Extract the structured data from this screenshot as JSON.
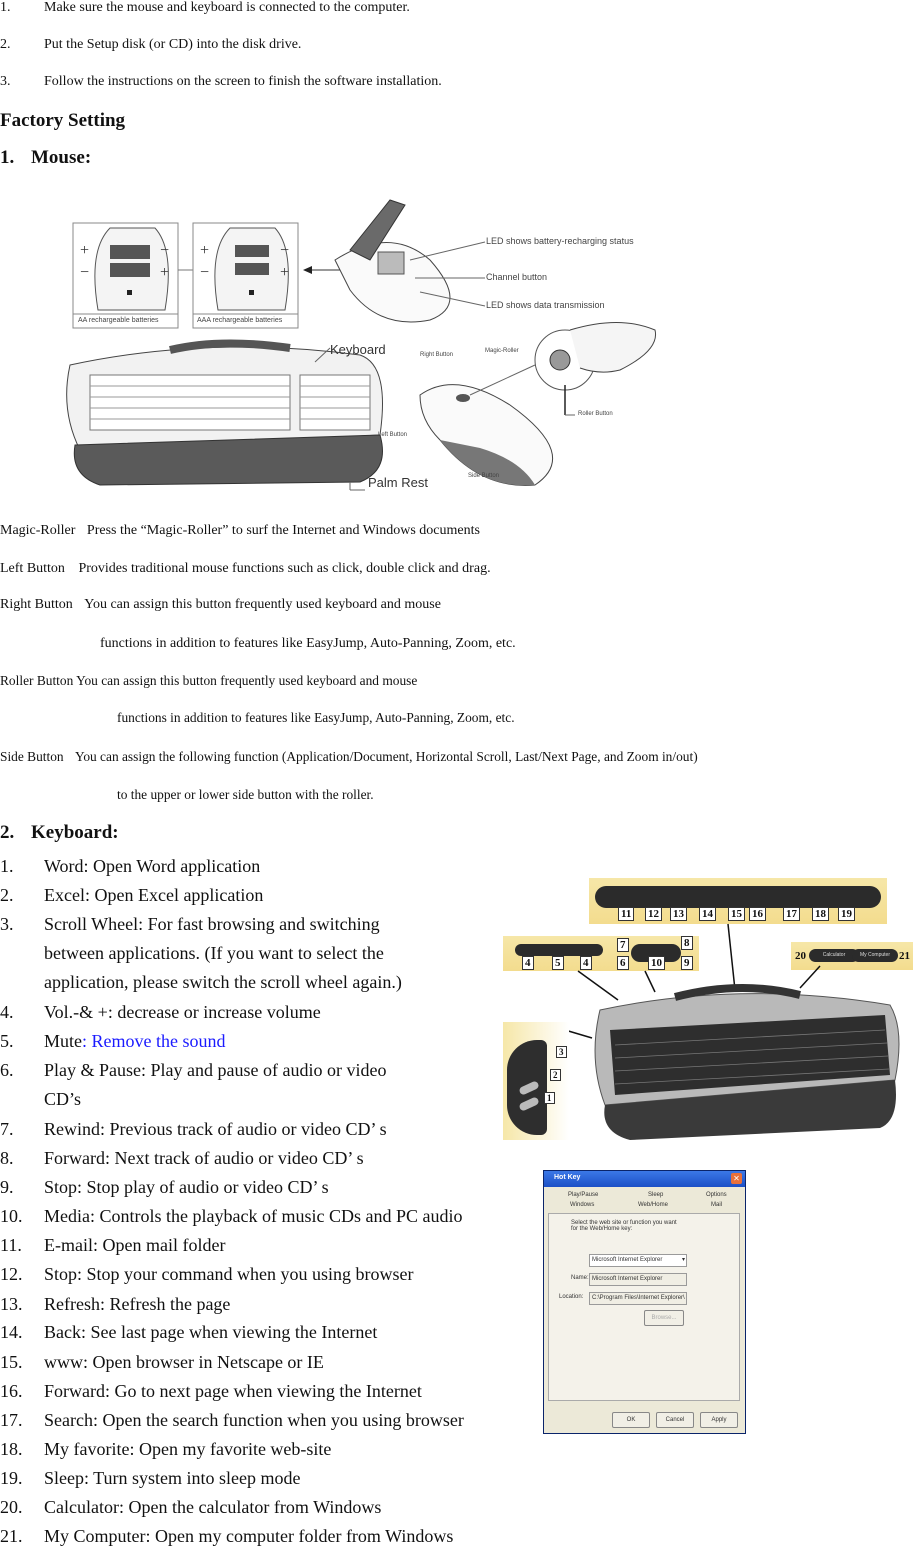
{
  "install_steps": [
    {
      "num": "1.",
      "text": "Make sure the mouse and keyboard is connected to the computer."
    },
    {
      "num": "2.",
      "text": "Put the Setup disk (or CD) into the disk drive."
    },
    {
      "num": "3.",
      "text": "Follow the instructions on the screen to finish the software installation."
    }
  ],
  "factory_heading": "Factory Setting",
  "mouse_heading": {
    "num": "1.",
    "title": "Mouse:"
  },
  "mouse_figure": {
    "battery_labels": [
      "AA rechargeable batteries",
      "AAA rechargeable batteries"
    ],
    "callouts": [
      "LED shows battery-recharging status",
      "Channel button",
      "LED shows data transmission"
    ],
    "keyboard_label": "Keyboard",
    "palm_rest_label": "Palm Rest",
    "mouse_labels": [
      "Right Button",
      "Magic-Roller",
      "Roller Button",
      "Left Button",
      "Side Button"
    ]
  },
  "mouse_definitions": [
    {
      "term": "Magic-Roller",
      "desc": "Press the “Magic-Roller” to surf the Internet and Windows documents",
      "cont": ""
    },
    {
      "term": "Left Button",
      "desc": "Provides traditional mouse functions such as click, double click and drag.",
      "cont": ""
    },
    {
      "term": "Right Button",
      "desc": "You can assign this button frequently used keyboard and mouse",
      "cont": "functions in addition to features like EasyJump, Auto-Panning, Zoom, etc."
    },
    {
      "term": "Roller Button",
      "desc": "You can assign this button frequently used keyboard and mouse",
      "cont": "functions in addition to features like EasyJump, Auto-Panning, Zoom, etc."
    },
    {
      "term": "Side Button",
      "desc": "You can assign the following function (Application/Document, Horizontal Scroll, Last/Next Page, and Zoom in/out)",
      "cont": "to the upper or lower side button with the roller."
    }
  ],
  "keyboard_heading": {
    "num": "2.",
    "title": "Keyboard:"
  },
  "keyboard_items": [
    {
      "num": "1.",
      "lines": [
        "Word: Open Word application"
      ]
    },
    {
      "num": "2.",
      "lines": [
        "Excel: Open Excel application"
      ]
    },
    {
      "num": "3.",
      "lines": [
        "Scroll Wheel: For fast browsing and switching",
        "between applications. (If you want to select the",
        "application, please switch the scroll wheel again.)"
      ]
    },
    {
      "num": "4.",
      "lines": [
        "Vol.-& +: decrease or increase volume"
      ]
    },
    {
      "num": "5.",
      "label": "Mute",
      "highlight": ": Remove the sound",
      "highlight_color": "#1a1aff"
    },
    {
      "num": "6.",
      "lines": [
        "Play & Pause: Play and pause of audio or video",
        "CD’s"
      ]
    },
    {
      "num": "7.",
      "lines": [
        "Rewind: Previous track of audio or video CD’ s"
      ]
    },
    {
      "num": "8.",
      "lines": [
        "Forward: Next track of audio or video CD’ s"
      ]
    },
    {
      "num": "9.",
      "lines": [
        "Stop: Stop play of audio or video CD’ s"
      ]
    },
    {
      "num": "10.",
      "lines": [
        "Media: Controls the playback of music CDs and PC audio"
      ]
    },
    {
      "num": "11.",
      "lines": [
        "E-mail: Open mail folder"
      ]
    },
    {
      "num": "12.",
      "lines": [
        "Stop: Stop your command when you using browser"
      ]
    },
    {
      "num": "13.",
      "lines": [
        "Refresh: Refresh the page"
      ]
    },
    {
      "num": "14.",
      "lines": [
        "Back: See last page when viewing the Internet"
      ]
    },
    {
      "num": "15.",
      "lines": [
        "www: Open browser in Netscape or IE"
      ]
    },
    {
      "num": "16.",
      "lines": [
        "Forward: Go to next page when viewing the Internet"
      ]
    },
    {
      "num": "17.",
      "lines": [
        "Search: Open the search function when you using browser"
      ]
    },
    {
      "num": "18.",
      "lines": [
        "My favorite: Open my favorite web-site"
      ]
    },
    {
      "num": "19.",
      "lines": [
        "Sleep: Turn system into sleep mode"
      ]
    },
    {
      "num": "20.",
      "lines": [
        "Calculator: Open the calculator from Windows"
      ]
    },
    {
      "num": "21.",
      "lines": [
        "My Computer: Open my computer folder from Windows"
      ]
    }
  ],
  "keyboard_figure": {
    "top_callouts": [
      "11",
      "12",
      "13",
      "14",
      "15",
      "16",
      "17",
      "18",
      "19"
    ],
    "vol_callouts": [
      "4",
      "5",
      "4"
    ],
    "media_callouts": [
      "7",
      "8",
      "6",
      "10",
      "9"
    ],
    "right_callouts": [
      "20",
      "21"
    ],
    "right_keys": [
      "Calculator",
      "My Computer"
    ],
    "side_callouts": [
      "3",
      "2",
      "1"
    ]
  },
  "hotkey_dialog": {
    "title": "Hot Key",
    "tabs_row1": [
      "Play/Pause",
      "Sleep",
      "Options"
    ],
    "tabs_row2": [
      "Windows",
      "Web/Home",
      "Mail"
    ],
    "instruction": "Select the web site or function you want for the Web/Home key:",
    "dropdown_value": "Microsoft Internet Explorer",
    "name_label": "Name:",
    "name_value": "Microsoft Internet Explorer",
    "location_label": "Location:",
    "location_value": "C:\\Program Files\\Internet Explorer\\",
    "browse_label": "Browse...",
    "ok_label": "OK",
    "cancel_label": "Cancel",
    "apply_label": "Apply"
  }
}
